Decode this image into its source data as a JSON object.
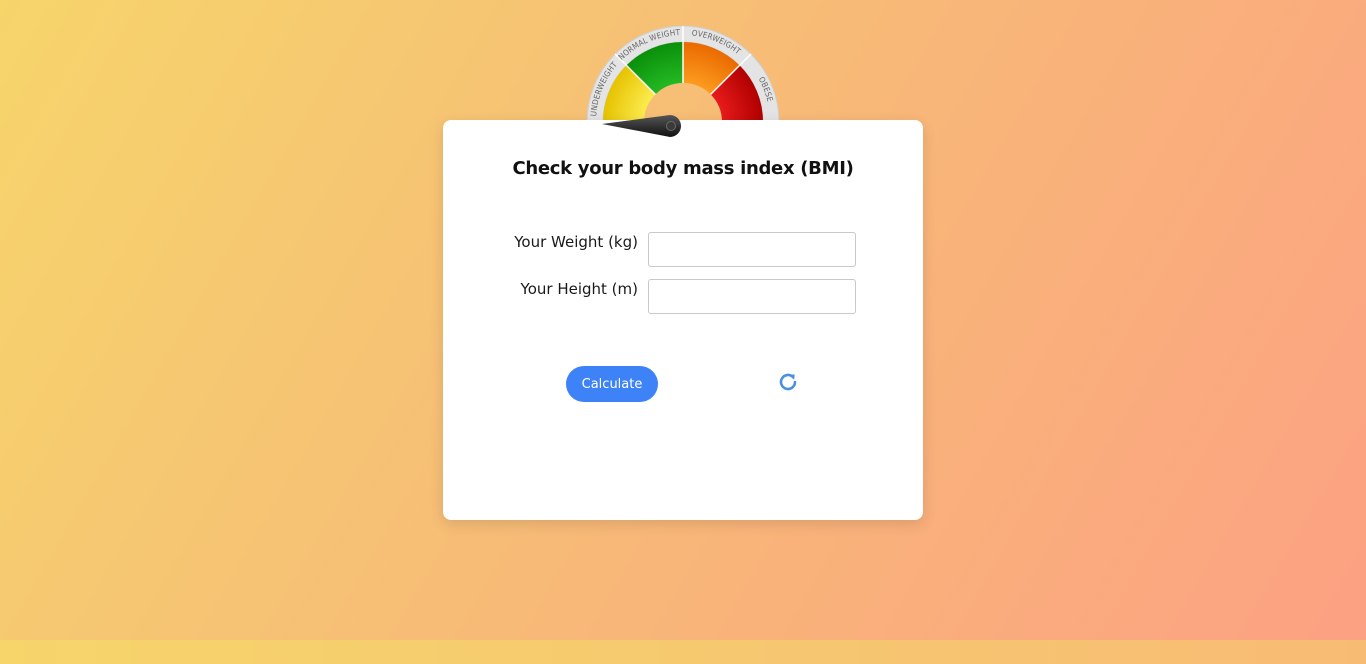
{
  "gauge": {
    "segments": [
      {
        "label": "UNDERWEIGHT",
        "color": "#f7e01a"
      },
      {
        "label": "NORMAL WEIGHT",
        "color": "#14a514"
      },
      {
        "label": "OVERWEIGHT",
        "color": "#f7870f"
      },
      {
        "label": "OBESE",
        "color": "#d80c0c"
      }
    ]
  },
  "card": {
    "title": "Check your body mass index (BMI)",
    "weight_label": "Your Weight (kg)",
    "weight_value": "",
    "height_label": "Your Height (m)",
    "height_value": "",
    "calculate_label": "Calculate",
    "reset_icon": "refresh-icon"
  },
  "colors": {
    "accent": "#3e82f7",
    "reset_icon": "#4a8fe0"
  }
}
